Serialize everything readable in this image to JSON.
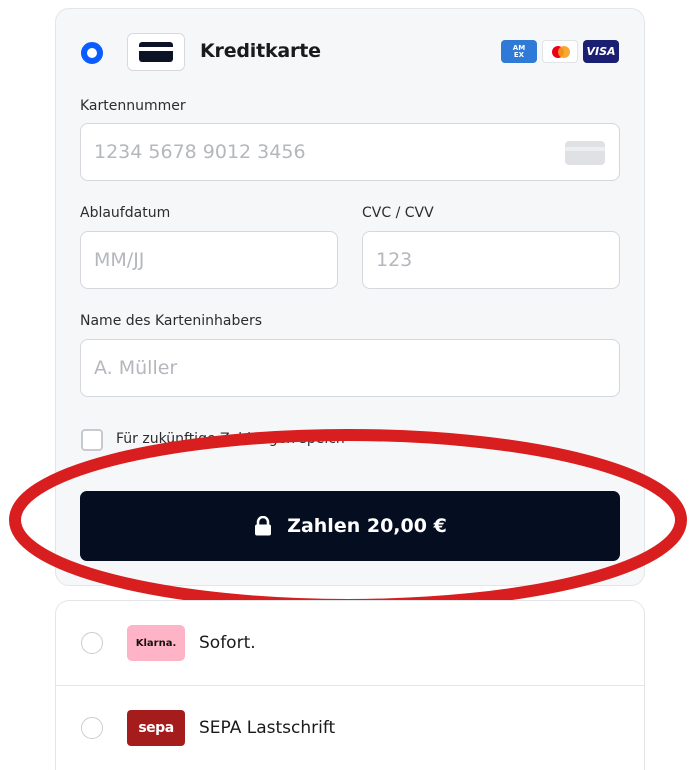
{
  "card_method": {
    "title": "Kreditkarte",
    "brands": [
      "AM EX",
      "Mastercard",
      "VISA"
    ]
  },
  "card_number": {
    "label": "Kartennummer",
    "placeholder": "1234 5678 9012 3456"
  },
  "expiry": {
    "label": "Ablaufdatum",
    "placeholder": "MM/JJ"
  },
  "cvc": {
    "label": "CVC / CVV",
    "placeholder": "123"
  },
  "cardholder": {
    "label": "Name des Karteninhabers",
    "placeholder": "A. Müller"
  },
  "save_card": {
    "label": "Für zukünftige Zahlungen speichern",
    "checked": false
  },
  "pay_button": {
    "label": "Zahlen 20,00 €"
  },
  "other_methods": [
    {
      "badge": "Klarna.",
      "label": "Sofort."
    },
    {
      "badge": "sepa",
      "label": "SEPA Lastschrift"
    }
  ],
  "colors": {
    "accent": "#0b5cff",
    "button": "#050d20",
    "annotation": "#d81e1e"
  }
}
